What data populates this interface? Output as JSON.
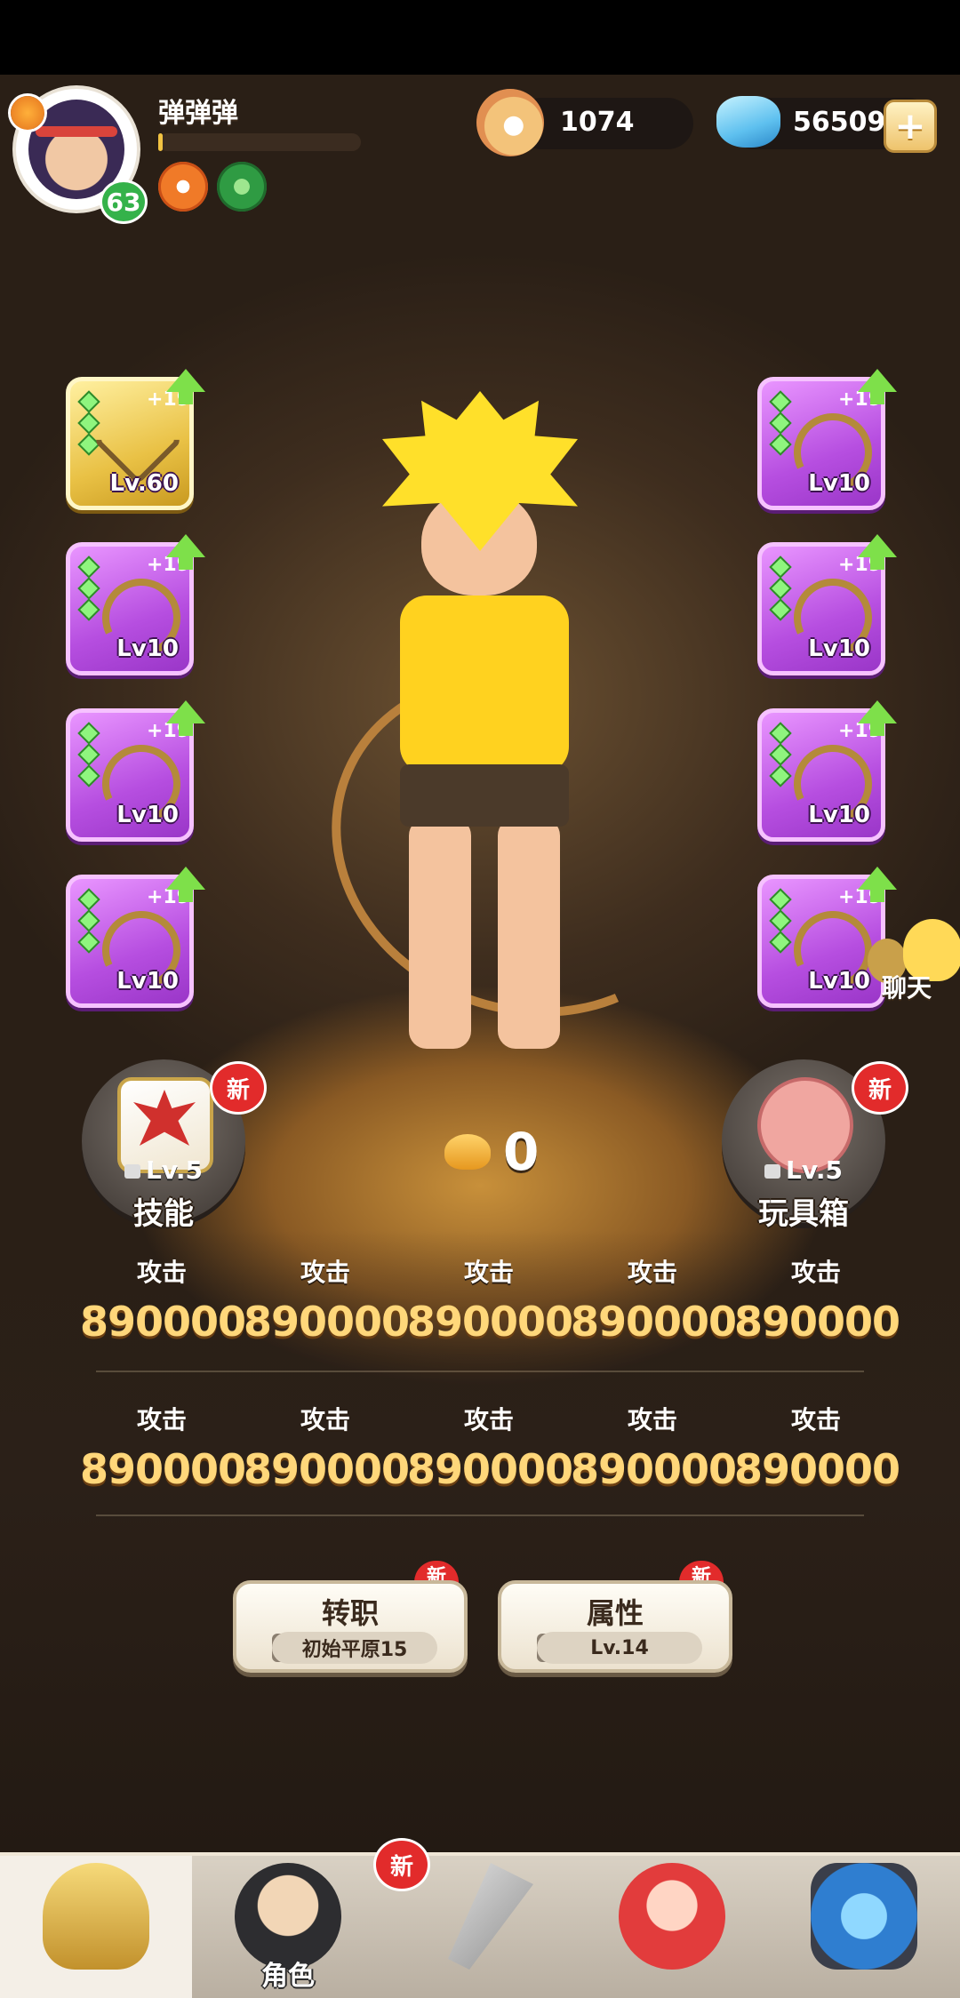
{
  "player": {
    "name": "弹弹弹",
    "level": "63",
    "xp_fraction": 0.02
  },
  "currency": {
    "pearl": "1074",
    "gem": "56509",
    "add_label": "+"
  },
  "equipment": {
    "left": [
      {
        "plus": "+19",
        "level": "Lv.60",
        "rarity": "gold",
        "icon": "bow-icon"
      },
      {
        "plus": "+19",
        "level": "Lv10",
        "rarity": "purple",
        "icon": "necklace-icon"
      },
      {
        "plus": "+19",
        "level": "Lv10",
        "rarity": "purple",
        "icon": "necklace-icon"
      },
      {
        "plus": "+19",
        "level": "Lv10",
        "rarity": "purple",
        "icon": "necklace-icon"
      }
    ],
    "right": [
      {
        "plus": "+19",
        "level": "Lv10",
        "rarity": "purple",
        "icon": "necklace-icon"
      },
      {
        "plus": "+19",
        "level": "Lv10",
        "rarity": "purple",
        "icon": "necklace-icon"
      },
      {
        "plus": "+19",
        "level": "Lv10",
        "rarity": "purple",
        "icon": "necklace-icon"
      },
      {
        "plus": "+19",
        "level": "Lv10",
        "rarity": "purple",
        "icon": "necklace-icon"
      }
    ]
  },
  "chat": {
    "label": "聊天"
  },
  "skill": {
    "title": "技能",
    "level": "Lv.5",
    "badge": "新"
  },
  "toybox": {
    "title": "玩具箱",
    "level": "Lv.5",
    "badge": "新"
  },
  "bones": {
    "value": "0"
  },
  "stats": {
    "row1": [
      {
        "label": "攻击",
        "value": "890000"
      },
      {
        "label": "攻击",
        "value": "890000"
      },
      {
        "label": "攻击",
        "value": "890000"
      },
      {
        "label": "攻击",
        "value": "890000"
      },
      {
        "label": "攻击",
        "value": "890000"
      }
    ],
    "row2": [
      {
        "label": "攻击",
        "value": "890000"
      },
      {
        "label": "攻击",
        "value": "890000"
      },
      {
        "label": "攻击",
        "value": "890000"
      },
      {
        "label": "攻击",
        "value": "890000"
      },
      {
        "label": "攻击",
        "value": "890000"
      }
    ]
  },
  "actions": {
    "transfer": {
      "label": "转职",
      "requirement": "初始平原15",
      "badge": "新"
    },
    "attributes": {
      "label": "属性",
      "requirement": "Lv.14",
      "badge": "新"
    }
  },
  "nav": {
    "tabs": [
      {
        "label": "",
        "icon": "home-hut-icon"
      },
      {
        "label": "角色",
        "icon": "character-icon",
        "badge": "新"
      },
      {
        "label": "",
        "icon": "weapon-icon"
      },
      {
        "label": "",
        "icon": "pet-icon"
      },
      {
        "label": "",
        "icon": "portal-icon"
      }
    ]
  }
}
